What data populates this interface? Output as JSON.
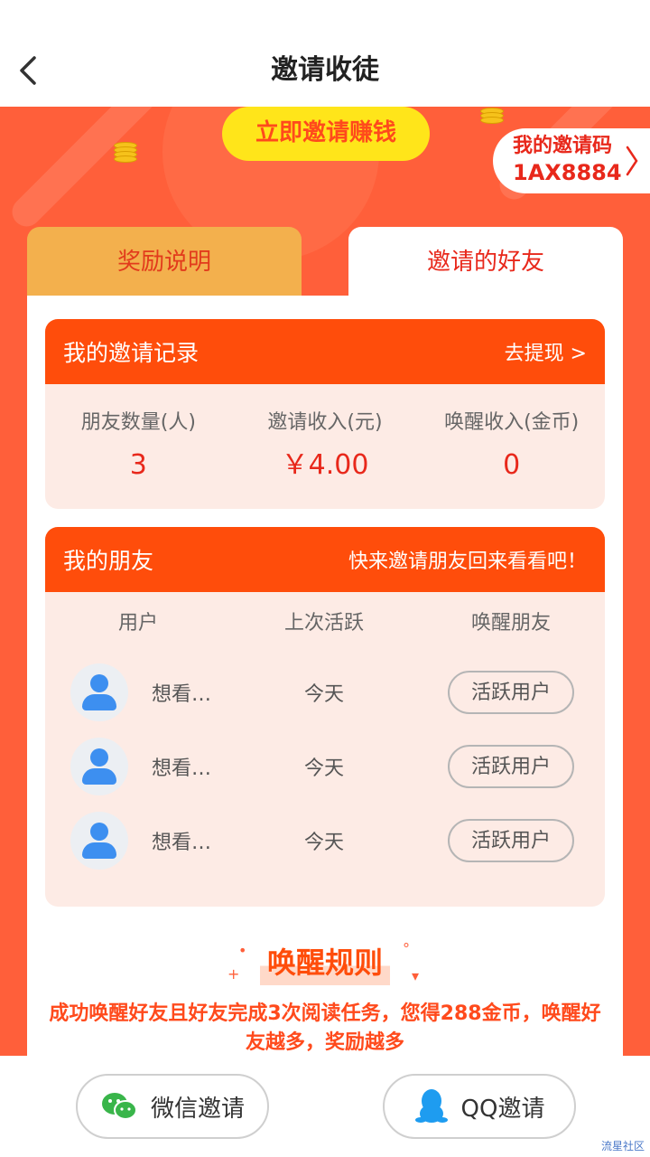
{
  "header": {
    "title": "邀请收徒"
  },
  "banner": {
    "invite_now_label": "立即邀请赚钱",
    "code_label": "我的邀请码",
    "code_value": "1AX8884"
  },
  "tabs": [
    {
      "label": "奖励说明",
      "active": false
    },
    {
      "label": "邀请的好友",
      "active": true
    }
  ],
  "invite_records": {
    "title": "我的邀请记录",
    "link_label": "去提现 >",
    "stats": [
      {
        "label": "朋友数量(人)",
        "value": "3"
      },
      {
        "label": "邀请收入(元)",
        "value": "￥4.00"
      },
      {
        "label": "唤醒收入(金币)",
        "value": "0"
      }
    ]
  },
  "friends": {
    "title": "我的朋友",
    "tip": "快来邀请朋友回来看看吧！",
    "columns": [
      "用户",
      "上次活跃",
      "唤醒朋友"
    ],
    "rows": [
      {
        "name": "想看…",
        "last_active": "今天",
        "action": "活跃用户"
      },
      {
        "name": "想看…",
        "last_active": "今天",
        "action": "活跃用户"
      },
      {
        "name": "想看…",
        "last_active": "今天",
        "action": "活跃用户"
      }
    ]
  },
  "rules": {
    "title": "唤醒规则",
    "text": "成功唤醒好友且好友完成3次阅读任务，您得288金币，唤醒好友越多，奖励越多"
  },
  "share": {
    "wechat_label": "微信邀请",
    "qq_label": "QQ邀请"
  },
  "watermark": "流星社区",
  "colors": {
    "primary": "#ff5f3a",
    "accent": "#ff4d0b",
    "highlight": "#ffe51a",
    "tab_inactive": "#f3b04d",
    "card_bg": "#fdebe5"
  },
  "icons": [
    "back-arrow-icon",
    "chevron-right-icon",
    "coin-stack-icon",
    "avatar-icon",
    "wechat-icon",
    "qq-icon"
  ]
}
